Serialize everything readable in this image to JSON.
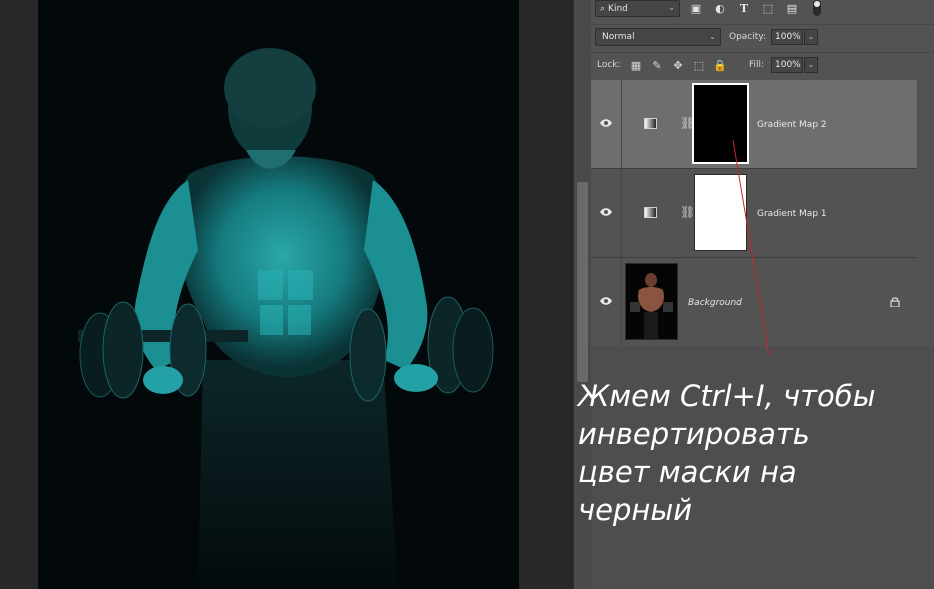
{
  "layers_panel": {
    "filter_kind": "Kind",
    "blend_mode": "Normal",
    "opacity_label": "Opacity:",
    "opacity_value": "100%",
    "lock_label": "Lock:",
    "fill_label": "Fill:",
    "fill_value": "100%",
    "layers": [
      {
        "name": "Gradient Map 2",
        "mask": "black",
        "selected": true
      },
      {
        "name": "Gradient Map 1",
        "mask": "white",
        "selected": false
      },
      {
        "name": "Background",
        "locked": true
      }
    ]
  },
  "annotation": {
    "line1": "Жмем Ctrl+I, чтобы",
    "line2": "инвертировать",
    "line3": "цвет маски на",
    "line4": "черный",
    "color": "#ffffff"
  },
  "colors": {
    "accent_line": "#c0282d",
    "image_tint": "#2ec4c8"
  }
}
